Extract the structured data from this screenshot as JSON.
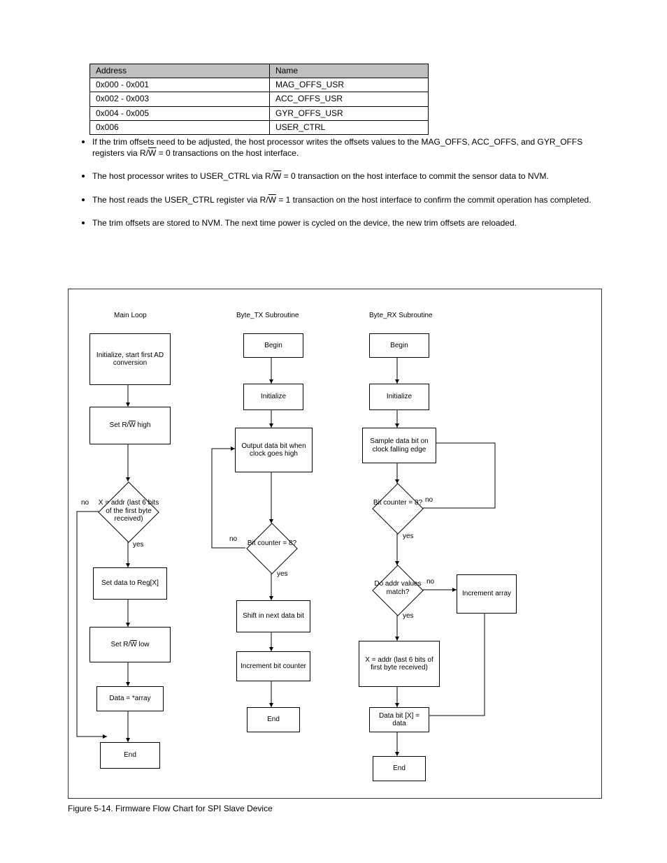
{
  "table": {
    "h1": "Address",
    "h2": "Name",
    "r": [
      [
        "0x000 - 0x001",
        "MAG_OFFS_USR"
      ],
      [
        "0x002 - 0x003",
        "ACC_OFFS_USR"
      ],
      [
        "0x004 - 0x005",
        "GYR_OFFS_USR"
      ],
      [
        "0x006",
        "USER_CTRL"
      ]
    ]
  },
  "bullets": [
    {
      "text": "If the trim offsets need to be adjusted, the host processor writes the offsets values to the MAG_OFFS, ACC_OFFS, and GYR_OFFS registers via R/",
      "t2": " = 0 transactions on the host interface."
    },
    {
      "text": "The host processor writes to USER_CTRL via R/",
      "t2": " = 0 transaction on the host interface to commit the sensor data to NVM."
    },
    {
      "text": "The host reads the USER_CTRL register via R/",
      "t2": " = 1 transaction on the host interface to confirm the commit operation has completed."
    },
    {
      "text": "The trim offsets are stored to NVM. The next time power is cycled on the device, the new trim offsets are reloaded."
    }
  ],
  "fc": {
    "col1": {
      "title": "Main Loop",
      "b1": "Initialize, start first AD conversion",
      "b2": "Set R/W high",
      "d1": "X = addr (last 6 bits of the first byte received)",
      "b3": "Set data to Reg[X]",
      "b4": "Set R/W low",
      "b5": "Data = *array",
      "b6": "End",
      "no": "no",
      "yes": "yes"
    },
    "col2": {
      "title": "Byte_TX Subroutine",
      "b1": "Begin",
      "b2": "Initialize",
      "b3": "Output data bit when clock goes high",
      "d1": "Bit counter = 8?",
      "b4": "Shift in next data bit",
      "b5": "Increment bit counter",
      "b6": "End",
      "no": "no",
      "yes": "yes"
    },
    "col3": {
      "title": "Byte_RX Subroutine",
      "b1": "Begin",
      "b2": "Initialize",
      "b3": "Sample data bit on clock falling edge",
      "d1": "Bit counter = 8?",
      "d2": "Do addr values match?",
      "side": "Increment array",
      "b4": "X = addr (last 6 bits of first byte received)",
      "b5": "Data bit [X] = data",
      "b6": "End",
      "no": "no",
      "yes": "yes"
    }
  },
  "figcap": "Figure 5-14. Firmware Flow Chart for SPI Slave Device"
}
